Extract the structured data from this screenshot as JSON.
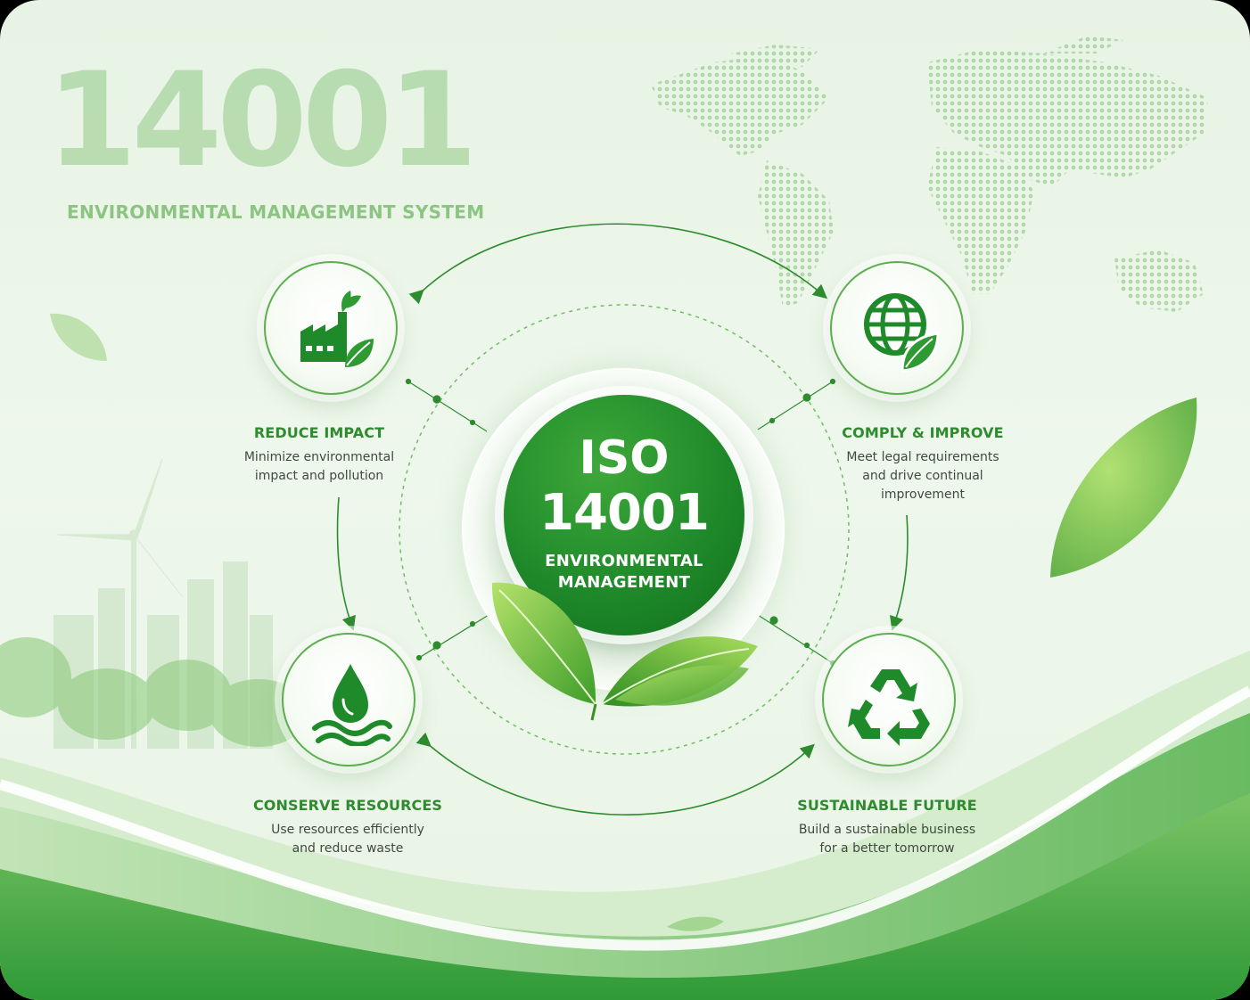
{
  "hero": {
    "number": "14001",
    "subtitle": "ENVIRONMENTAL MANAGEMENT SYSTEM"
  },
  "center": {
    "line1": "ISO",
    "line2": "14001",
    "line3": "ENVIRONMENTAL",
    "line4": "MANAGEMENT"
  },
  "nodes": [
    {
      "title": "REDUCE IMPACT",
      "desc": [
        "Minimize environmental",
        "impact and pollution"
      ],
      "icon": "factory-leaf-icon"
    },
    {
      "title": "COMPLY & IMPROVE",
      "desc": [
        "Meet legal requirements",
        "and drive continual",
        "improvement"
      ],
      "icon": "globe-leaf-icon"
    },
    {
      "title": "CONSERVE RESOURCES",
      "desc": [
        "Use resources efficiently",
        "and reduce waste"
      ],
      "icon": "water-drop-icon"
    },
    {
      "title": "SUSTAINABLE FUTURE",
      "desc": [
        "Build a sustainable business",
        "for a better tomorrow"
      ],
      "icon": "recycle-icon"
    }
  ],
  "colors": {
    "primary_green": "#1f8a2a",
    "label_green": "#2e8b2e",
    "text_dark": "#3f4a3d",
    "background": "#e7f3e4"
  }
}
